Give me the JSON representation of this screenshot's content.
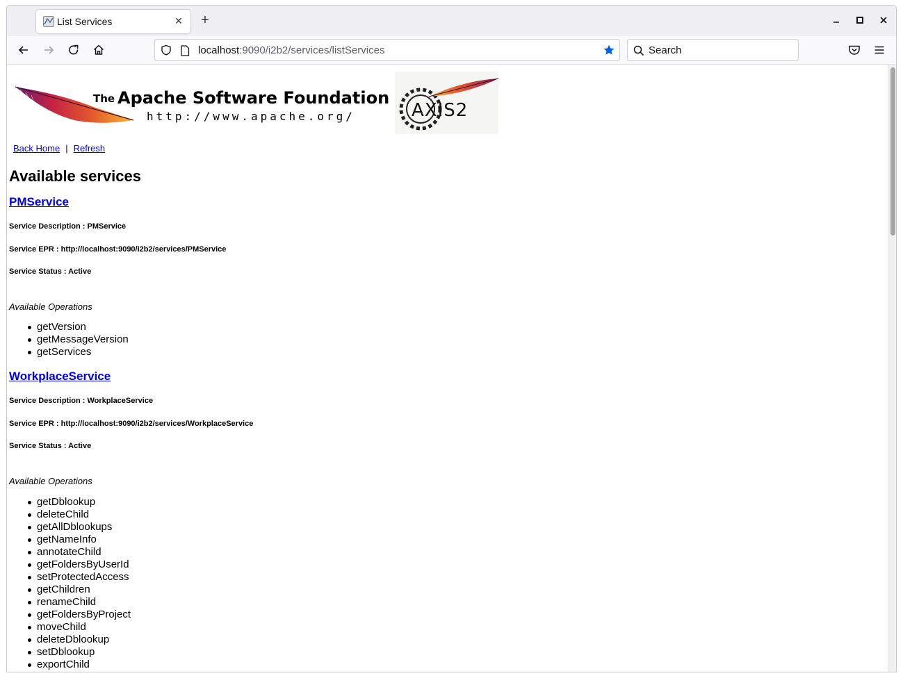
{
  "browser": {
    "tab_title": "List Services",
    "url_host": "localhost",
    "url_rest": ":9090/i2b2/services/listServices",
    "search_placeholder": "Search",
    "accent_color": "#0060df"
  },
  "page": {
    "banner": {
      "the": "The",
      "foundation": "Apache Software Foundation",
      "website": "http://www.apache.org/",
      "axis_logo": "AXIS2"
    },
    "links": {
      "back_home": "Back Home",
      "separator": "|",
      "refresh": "Refresh"
    },
    "heading": "Available services",
    "services": [
      {
        "name": "PMService",
        "description": "Service Description : PMService",
        "epr": "Service EPR : http://localhost:9090/i2b2/services/PMService",
        "status": "Service Status : Active",
        "ops_label": "Available Operations",
        "operations": [
          "getVersion",
          "getMessageVersion",
          "getServices"
        ]
      },
      {
        "name": "WorkplaceService",
        "description": "Service Description : WorkplaceService",
        "epr": "Service EPR : http://localhost:9090/i2b2/services/WorkplaceService",
        "status": "Service Status : Active",
        "ops_label": "Available Operations",
        "operations": [
          "getDblookup",
          "deleteChild",
          "getAllDblookups",
          "getNameInfo",
          "annotateChild",
          "getFoldersByUserId",
          "setProtectedAccess",
          "getChildren",
          "renameChild",
          "getFoldersByProject",
          "moveChild",
          "deleteDblookup",
          "setDblookup",
          "exportChild"
        ]
      }
    ]
  }
}
